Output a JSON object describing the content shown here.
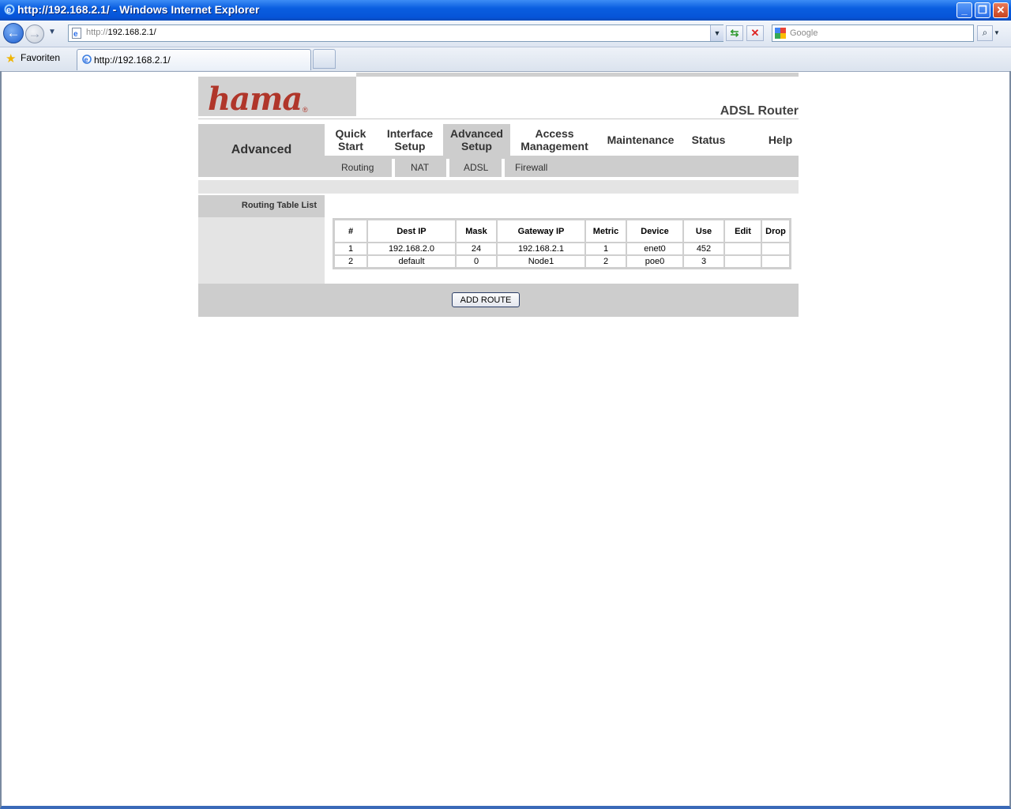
{
  "window": {
    "title": "http://192.168.2.1/ - Windows Internet Explorer",
    "buttons": {
      "minimize": "_",
      "maximize": "❐",
      "close": "✕"
    }
  },
  "navbar": {
    "address_proto": "http://",
    "address_host": "192.168.2.1/",
    "search_placeholder": "Google"
  },
  "favorites": {
    "label": "Favoriten",
    "tab_title": "http://192.168.2.1/"
  },
  "router": {
    "logo": "hama",
    "logo_mark": "®",
    "product": "ADSL Router",
    "section": "Advanced",
    "main_nav": [
      {
        "line1": "Quick",
        "line2": "Start"
      },
      {
        "line1": "Interface",
        "line2": "Setup"
      },
      {
        "line1": "Advanced",
        "line2": "Setup"
      },
      {
        "line1": "Access",
        "line2": "Management"
      },
      {
        "line1": "Maintenance",
        "line2": ""
      },
      {
        "line1": "Status",
        "line2": ""
      },
      {
        "line1": "Help",
        "line2": ""
      }
    ],
    "sub_nav": [
      "Routing",
      "NAT",
      "ADSL",
      "Firewall"
    ],
    "left_label": "Routing Table List",
    "table": {
      "headers": [
        "#",
        "Dest IP",
        "Mask",
        "Gateway IP",
        "Metric",
        "Device",
        "Use",
        "Edit",
        "Drop"
      ],
      "rows": [
        [
          "1",
          "192.168.2.0",
          "24",
          "192.168.2.1",
          "1",
          "enet0",
          "452",
          "",
          ""
        ],
        [
          "2",
          "default",
          "0",
          "Node1",
          "2",
          "poe0",
          "3",
          "",
          ""
        ]
      ]
    },
    "add_route_label": "ADD ROUTE"
  },
  "colors": {
    "titlebar": "#0a5ee0",
    "logo": "#b0362a",
    "panel_gray": "#cdcdcd",
    "light_gray": "#e4e4e4"
  }
}
